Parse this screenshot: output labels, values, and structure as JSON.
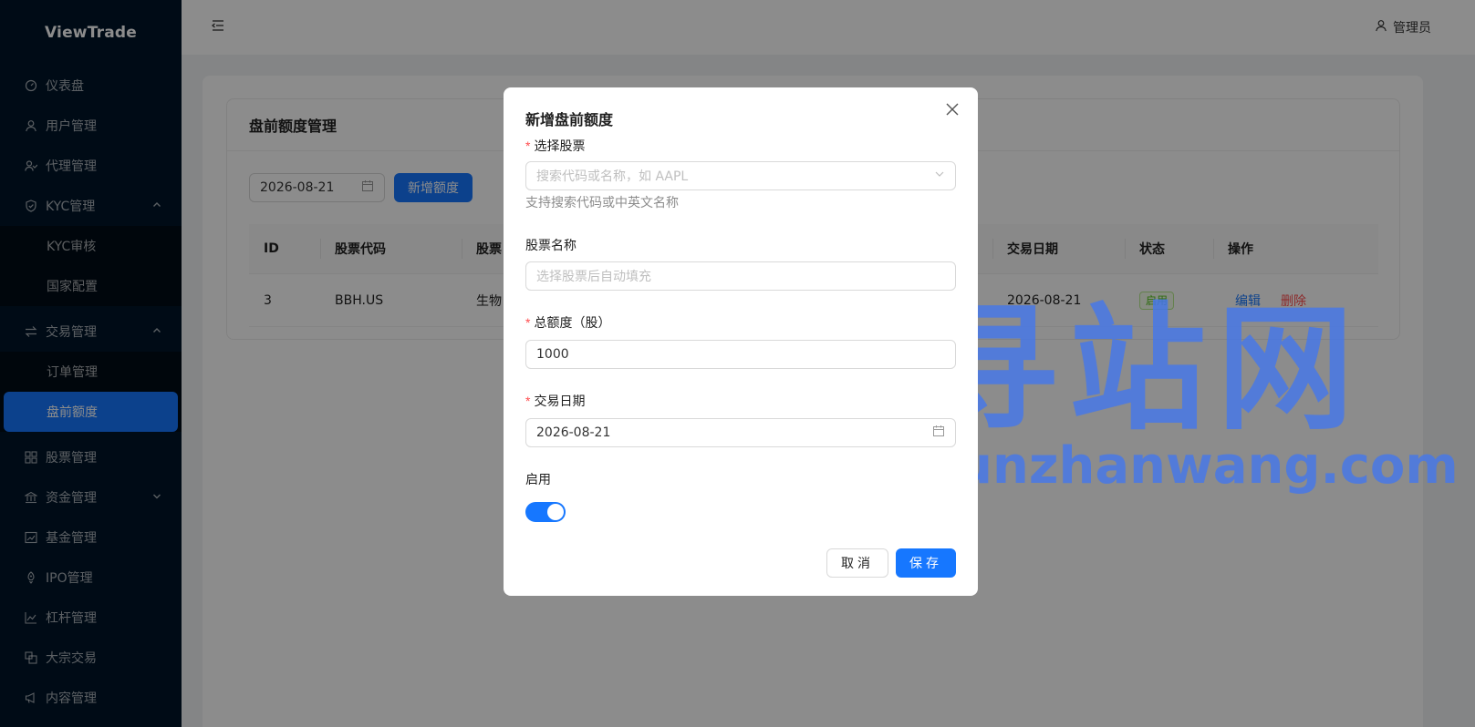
{
  "app": {
    "logo": "ViewTrade"
  },
  "header": {
    "user_label": "管理员"
  },
  "sidebar": {
    "items": [
      {
        "label": "仪表盘",
        "icon": "dashboard-icon"
      },
      {
        "label": "用户管理",
        "icon": "user-icon"
      },
      {
        "label": "代理管理",
        "icon": "agent-icon"
      },
      {
        "label": "KYC管理",
        "icon": "shield-icon",
        "expanded": true,
        "children": [
          {
            "label": "KYC审核"
          },
          {
            "label": "国家配置"
          }
        ]
      },
      {
        "label": "交易管理",
        "icon": "swap-icon",
        "expanded": true,
        "children": [
          {
            "label": "订单管理"
          },
          {
            "label": "盘前额度",
            "active": true
          }
        ]
      },
      {
        "label": "股票管理",
        "icon": "grid-icon"
      },
      {
        "label": "资金管理",
        "icon": "bank-icon",
        "expanded": false
      },
      {
        "label": "基金管理",
        "icon": "fund-chart-icon"
      },
      {
        "label": "IPO管理",
        "icon": "rocket-icon"
      },
      {
        "label": "杠杆管理",
        "icon": "line-chart-icon"
      },
      {
        "label": "大宗交易",
        "icon": "block-trade-icon"
      },
      {
        "label": "内容管理",
        "icon": "megaphone-icon"
      }
    ]
  },
  "page": {
    "title": "盘前额度管理",
    "date_filter": "2026-08-21",
    "add_button": "新增额度",
    "table": {
      "columns": [
        "ID",
        "股票代码",
        "股票",
        "交易日期",
        "状态",
        "操作"
      ],
      "rows": [
        {
          "id": "3",
          "code": "BBH.US",
          "name": "生物",
          "date": "2026-08-21",
          "status": "启用",
          "edit": "编辑",
          "delete": "删除"
        }
      ]
    }
  },
  "modal": {
    "title": "新增盘前额度",
    "stock_label": "选择股票",
    "stock_placeholder": "搜索代码或名称，如 AAPL",
    "stock_help": "支持搜索代码或中英文名称",
    "name_label": "股票名称",
    "name_placeholder": "选择股票后自动填充",
    "quota_label": "总额度（股）",
    "quota_value": "1000",
    "date_label": "交易日期",
    "date_value": "2026-08-21",
    "enabled_label": "启用",
    "enabled": true,
    "cancel": "取消",
    "save": "保存"
  },
  "watermark": {
    "cn": "寻站网",
    "en": "xunzhanwang.com"
  },
  "colors": {
    "primary": "#1677ff",
    "sidebar_bg": "#001529",
    "danger": "#ff4d4f",
    "success": "#52c41a"
  }
}
